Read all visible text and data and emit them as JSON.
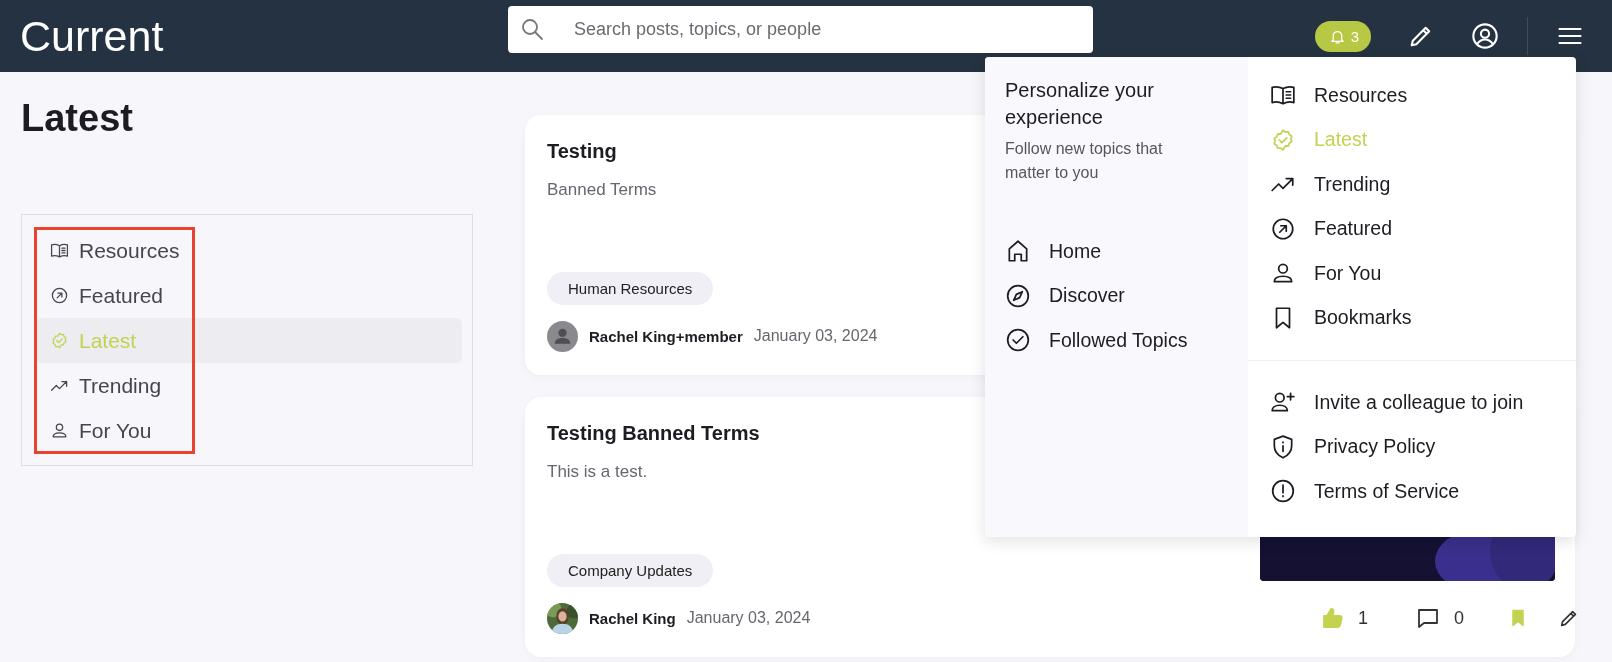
{
  "header": {
    "logo": "Current",
    "search": {
      "placeholder": "Search posts, topics, or people"
    },
    "notifications": {
      "count": "3"
    }
  },
  "page_title": "Latest",
  "sidebar": {
    "highlight_frame": true,
    "items": [
      {
        "label": "Resources",
        "selected": false
      },
      {
        "label": "Featured",
        "selected": false
      },
      {
        "label": "Latest",
        "selected": true
      },
      {
        "label": "Trending",
        "selected": false
      },
      {
        "label": "For You",
        "selected": false
      }
    ]
  },
  "posts": [
    {
      "title": "Testing",
      "body": "Banned Terms",
      "tag": "Human Resources",
      "author": "Rachel King+member",
      "date": "January 03, 2024",
      "avatar": {
        "kind": "placeholder"
      }
    },
    {
      "title": "Testing Banned Terms",
      "body": "This is a test.",
      "tag": "Company Updates",
      "author": "Rachel King",
      "date": "January 03, 2024",
      "actions": {
        "likes": "1",
        "liked": true,
        "comments": "0",
        "bookmarked": true
      }
    }
  ],
  "menu": {
    "heading": "Personalize your experience",
    "subheading": "Follow new topics that matter to you",
    "primary": [
      {
        "label": "Home"
      },
      {
        "label": "Discover"
      },
      {
        "label": "Followed Topics"
      }
    ],
    "links": [
      {
        "label": "Resources",
        "selected": false
      },
      {
        "label": "Latest",
        "selected": true
      },
      {
        "label": "Trending",
        "selected": false
      },
      {
        "label": "Featured",
        "selected": false
      },
      {
        "label": "For You",
        "selected": false
      },
      {
        "label": "Bookmarks",
        "selected": false
      }
    ],
    "footer_links": [
      {
        "label": "Invite a colleague to join"
      },
      {
        "label": "Privacy Policy"
      },
      {
        "label": "Terms of Service"
      }
    ]
  }
}
